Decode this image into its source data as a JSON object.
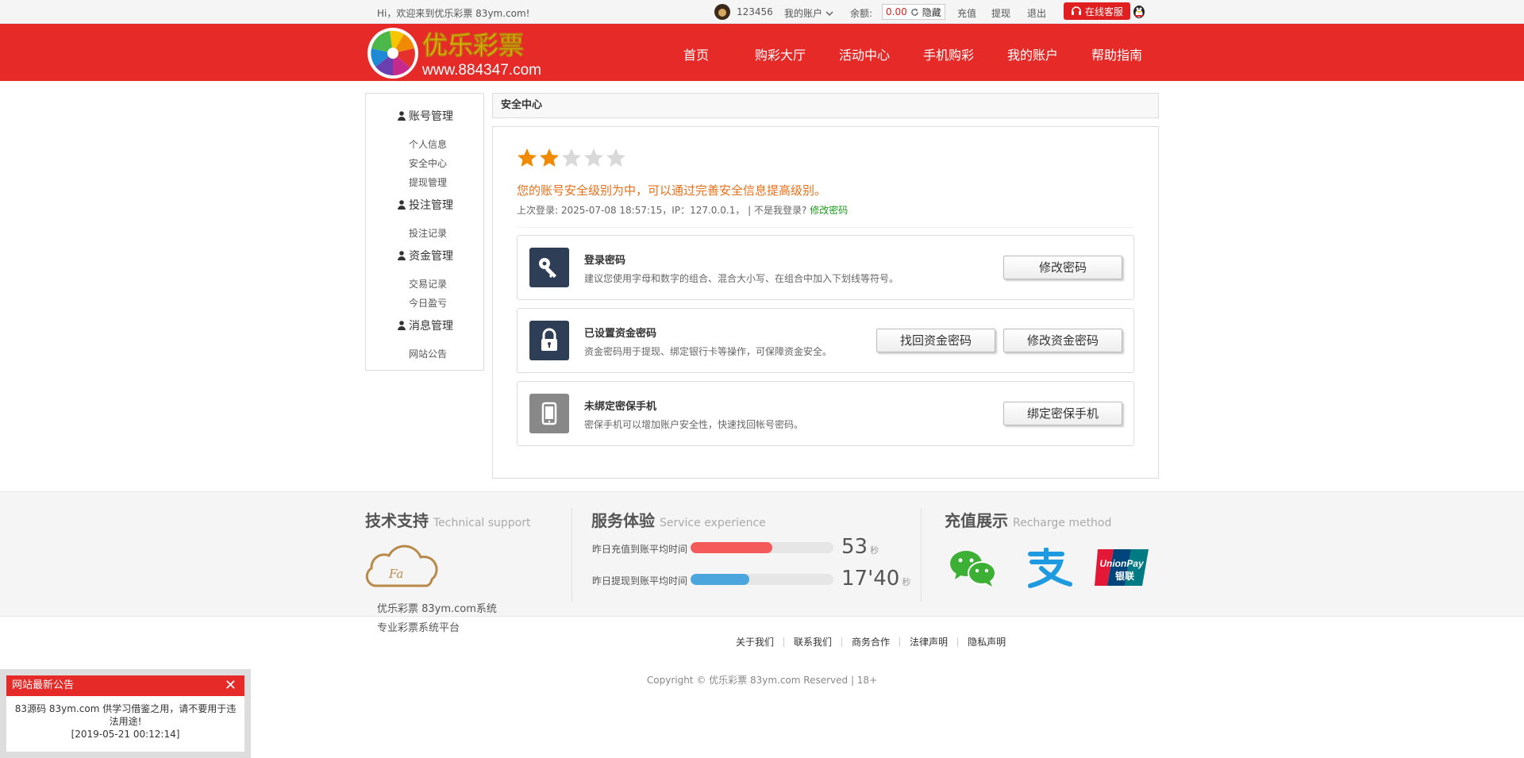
{
  "topbar": {
    "welcome": "Hi，欢迎来到优乐彩票 83ym.com!",
    "username": "123456",
    "account_menu": "我的账户",
    "balance_label": "余额:",
    "balance": "0.00",
    "hide": "隐藏",
    "recharge": "充值",
    "withdraw": "提现",
    "logout": "退出",
    "customer_service": "在线客服"
  },
  "header": {
    "logo_text": "优乐彩票",
    "logo_url": "www.884347.com",
    "nav": [
      "首页",
      "购彩大厅",
      "活动中心",
      "手机购彩",
      "我的账户",
      "帮助指南"
    ]
  },
  "sidebar": {
    "groups": [
      {
        "title": "账号管理",
        "items": [
          "个人信息",
          "安全中心",
          "提现管理"
        ]
      },
      {
        "title": "投注管理",
        "items": [
          "投注记录"
        ]
      },
      {
        "title": "资金管理",
        "items": [
          "交易记录",
          "今日盈亏"
        ]
      },
      {
        "title": "消息管理",
        "items": [
          "网站公告"
        ]
      }
    ]
  },
  "main": {
    "breadcrumb": "安全中心",
    "rating": {
      "filled": 2,
      "total": 5
    },
    "level_text": "您的账号安全级别为中，可以通过完善安全信息提高级别。",
    "last_login": "上次登录: 2025-07-08 18:57:15，IP：127.0.0.1， | 不是我登录?",
    "change_pwd_link": "修改密码",
    "cards": [
      {
        "title": "登录密码",
        "desc": "建议您使用字母和数字的组合、混合大小写、在组合中加入下划线等符号。",
        "icon": "key-icon",
        "buttons": [
          "修改密码"
        ]
      },
      {
        "title": "已设置资金密码",
        "desc": "资金密码用于提现、绑定银行卡等操作，可保障资金安全。",
        "icon": "lock-icon",
        "buttons": [
          "找回资金密码",
          "修改资金密码"
        ]
      },
      {
        "title": "未绑定密保手机",
        "desc": "密保手机可以增加账户安全性，快速找回帐号密码。",
        "icon": "phone-icon",
        "buttons": [
          "绑定密保手机"
        ]
      }
    ]
  },
  "footer": {
    "tech": {
      "title": "技术支持",
      "en": "Technical support",
      "line1": "优乐彩票 83ym.com系统",
      "line2": "专业彩票系统平台",
      "logo_text": "Fa"
    },
    "service": {
      "title": "服务体验",
      "en": "Service experience",
      "rows": [
        {
          "label": "昨日充值到账平均时间",
          "value": "53",
          "unit": "秒",
          "fill": 0.57,
          "color": "#f45a5a"
        },
        {
          "label": "昨日提现到账平均时间",
          "value": "17'40",
          "unit": "秒",
          "fill": 0.41,
          "color": "#4aa6dc"
        }
      ]
    },
    "recharge": {
      "title": "充值展示",
      "en": "Recharge method",
      "unionpay_top": "UnionPay",
      "unionpay_bottom": "银联"
    },
    "links": [
      "关于我们",
      "联系我们",
      "商务合作",
      "法律声明",
      "隐私声明"
    ],
    "copyright": "Copyright © 优乐彩票 83ym.com Reserved | 18+"
  },
  "notice": {
    "title": "网站最新公告",
    "line1": "83源码 83ym.com 供学习借鉴之用，请不要用于违法用途!",
    "line2": "[2019-05-21 00:12:14]"
  },
  "colors": {
    "brand_red": "#e52a28",
    "orange": "#e8701a",
    "navy": "#2e3e57",
    "star": "#f08a00"
  }
}
